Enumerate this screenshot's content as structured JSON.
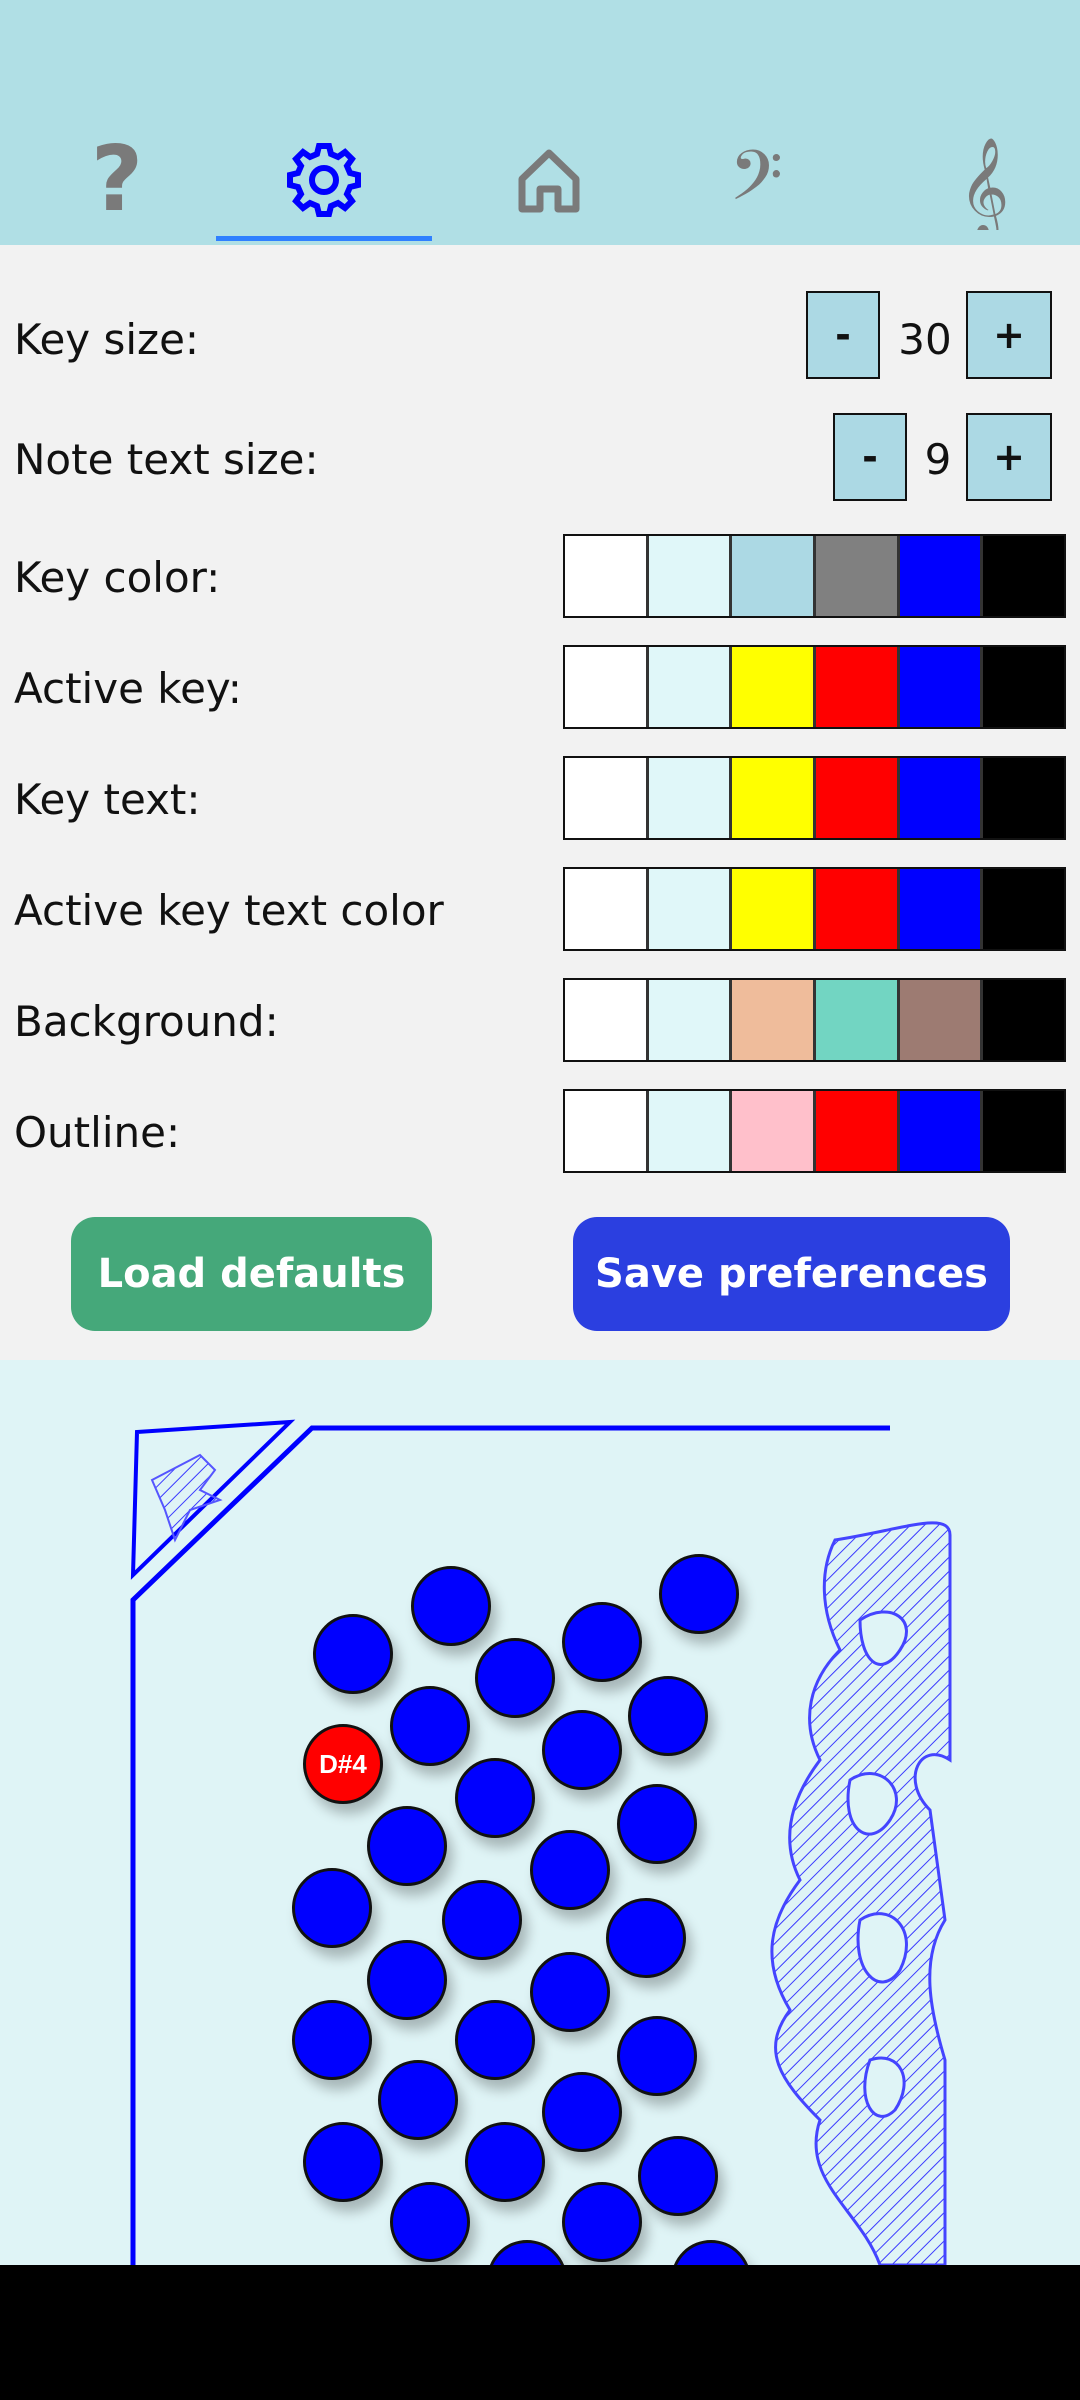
{
  "tabs": [
    {
      "name": "help-tab",
      "icon": "question-icon"
    },
    {
      "name": "settings-tab",
      "icon": "gear-icon",
      "selected": true
    },
    {
      "name": "home-tab",
      "icon": "home-icon"
    },
    {
      "name": "bass-tab",
      "icon": "bass-clef-icon"
    },
    {
      "name": "treble-tab",
      "icon": "treble-clef-icon"
    }
  ],
  "settings": {
    "key_size": {
      "label": "Key size:",
      "value": "30",
      "minus": "-",
      "plus": "+"
    },
    "note_text_size": {
      "label": "Note text size:",
      "value": "9",
      "minus": "-",
      "plus": "+"
    },
    "key_color": {
      "label": "Key color:",
      "colors": [
        "#ffffff",
        "#e0f7f9",
        "#acd9e4",
        "#808080",
        "#0000ff",
        "#000000"
      ]
    },
    "active_key": {
      "label": "Active key:",
      "colors": [
        "#ffffff",
        "#e0f7f9",
        "#ffff00",
        "#ff0000",
        "#0000ff",
        "#000000"
      ]
    },
    "key_text": {
      "label": "Key text:",
      "colors": [
        "#ffffff",
        "#e0f7f9",
        "#ffff00",
        "#ff0000",
        "#0000ff",
        "#000000"
      ]
    },
    "active_key_text": {
      "label": "Active key text color",
      "colors": [
        "#ffffff",
        "#e0f7f9",
        "#ffff00",
        "#ff0000",
        "#0000ff",
        "#000000"
      ]
    },
    "background": {
      "label": "Background:",
      "colors": [
        "#ffffff",
        "#e0f7f9",
        "#efbc9b",
        "#72d5c2",
        "#9d7b72",
        "#000000"
      ]
    },
    "outline": {
      "label": "Outline:",
      "colors": [
        "#ffffff",
        "#e0f7f9",
        "#ffc0cb",
        "#ff0000",
        "#0000ff",
        "#000000"
      ]
    }
  },
  "actions": {
    "load_defaults": "Load defaults",
    "save_preferences": "Save preferences"
  },
  "accordion": {
    "active_note": "D#4",
    "key_color": "#0000ff",
    "active_key_color": "#ff0000"
  }
}
